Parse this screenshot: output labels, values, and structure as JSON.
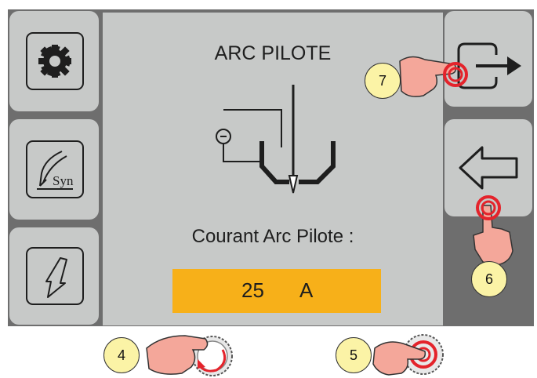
{
  "screen": {
    "title": "ARC PILOTE",
    "param_label": "Courant Arc Pilote :",
    "value": "25",
    "unit": "A"
  },
  "left_buttons": [
    {
      "icon": "gear-icon"
    },
    {
      "icon": "syn-torch-icon",
      "text": "Syn"
    },
    {
      "icon": "trigger-icon"
    }
  ],
  "right_buttons": [
    {
      "icon": "exit-arrow-icon"
    },
    {
      "icon": "back-arrow-icon"
    }
  ],
  "callouts": [
    "7",
    "6",
    "4",
    "5"
  ],
  "colors": {
    "frame": "#6e6e6e",
    "panel": "#c7c9c8",
    "value_bg": "#f7b019",
    "callout_bg": "#fbf3a6",
    "hand": "#f4a79a",
    "press_ring": "#e4232b"
  }
}
